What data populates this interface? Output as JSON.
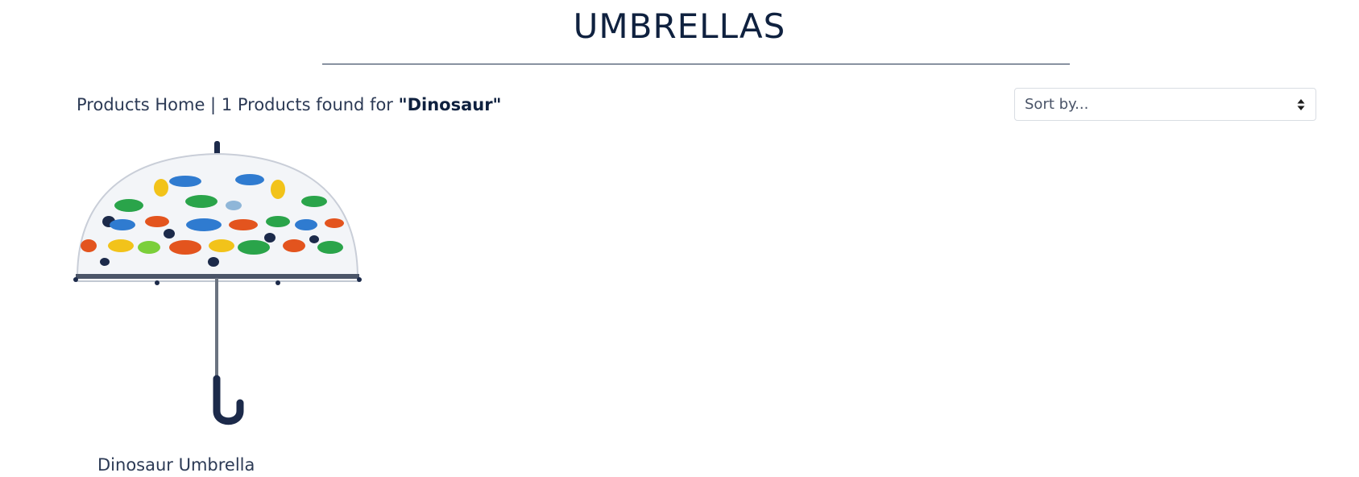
{
  "page": {
    "title": "UMBRELLAS"
  },
  "results": {
    "home_link": "Products Home",
    "separator": " | ",
    "count_text": "1 Products found for ",
    "query": "\"Dinosaur\""
  },
  "sort": {
    "placeholder": "Sort by..."
  },
  "products": [
    {
      "name": "Dinosaur Umbrella",
      "image": "dinosaur-umbrella-image"
    }
  ],
  "colors": {
    "title": "#0f213f",
    "text": "#2c3a55",
    "rule": "#22344f"
  }
}
